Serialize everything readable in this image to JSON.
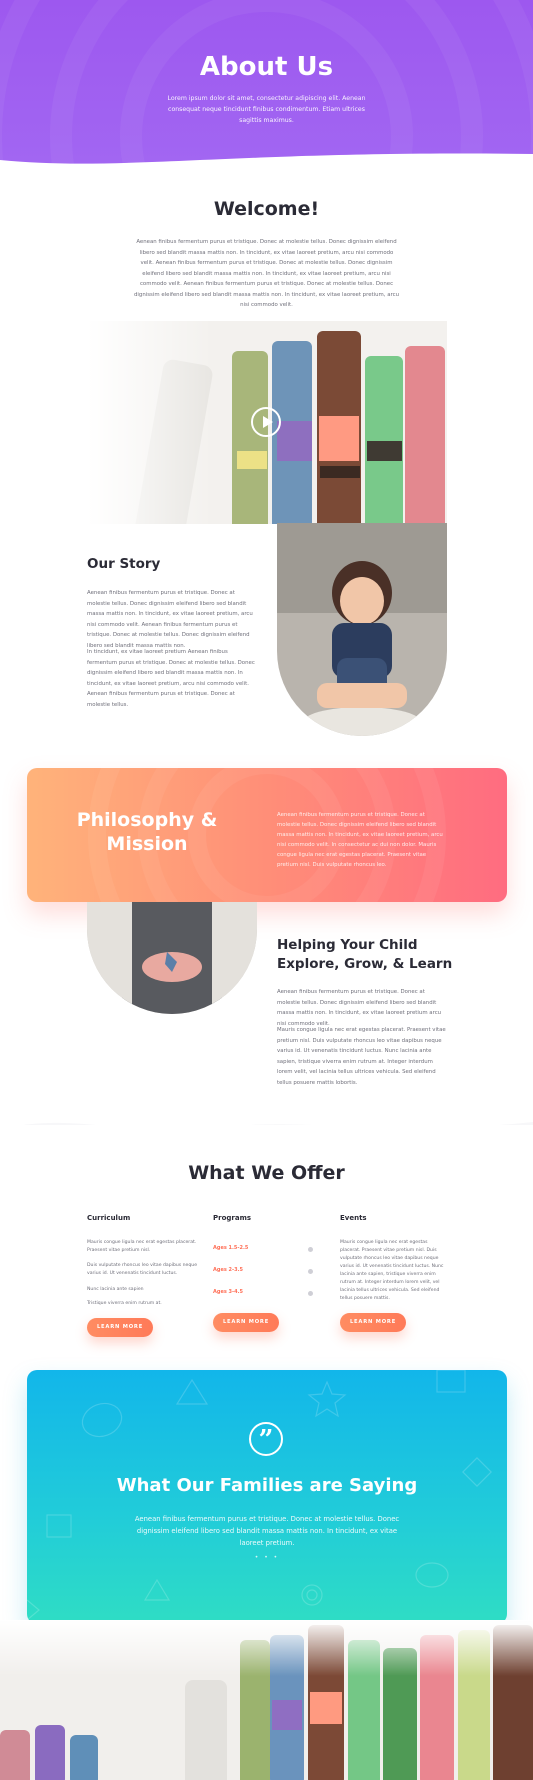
{
  "hero": {
    "title": "About Us",
    "subtitle": "Lorem ipsum dolor sit amet, consectetur adipiscing elit. Aenean consequat neque tincidunt finibus condimentum. Etiam ultrices sagittis maximus."
  },
  "welcome": {
    "title": "Welcome!",
    "text": "Aenean finibus fermentum purus et tristique. Donec at molestie tellus. Donec dignissim eleifend libero sed blandit massa mattis non. In tincidunt, ex vitae laoreet pretium, arcu nisi commodo velit. Aenean finibus fermentum purus et tristique. Donec at molestie tellus. Donec dignissim eleifend libero sed blandit massa mattis non. In tincidunt, ex vitae laoreet pretium, arcu nisi commodo velit. Aenean finibus fermentum purus et tristique. Donec at molestie tellus. Donec dignissim eleifend libero sed blandit massa mattis non. In tincidunt, ex vitae laoreet pretium, arcu nisi commodo velit."
  },
  "video": {
    "play_icon": "play-icon"
  },
  "story": {
    "title": "Our Story",
    "p1": "Aenean finibus fermentum purus et tristique. Donec at molestie tellus. Donec dignissim eleifend libero sed blandit massa mattis non. In tincidunt, ex vitae laoreet pretium, arcu nisi commodo velit. Aenean finibus fermentum purus et tristique. Donec at molestie tellus. Donec dignissim eleifend libero sed blandit massa mattis non.",
    "p2": "In tincidunt, ex vitae laoreet pretium Aenean finibus fermentum purus et tristique. Donec at molestie tellus. Donec dignissim eleifend libero sed blandit massa mattis non. In tincidunt, ex vitae laoreet pretium, arcu nisi commodo velit. Aenean finibus fermentum purus et tristique. Donec at molestie tellus."
  },
  "philosophy": {
    "title": "Philosophy & Mission",
    "text": "Aenean finibus fermentum purus et tristique. Donec at molestie tellus. Donec dignissim eleifend libero sed blandit massa mattis non. In tincidunt, ex vitae laoreet pretium, arcu nisi commodo velit. In consectetur ac dui non dolor. Mauris congue ligula nec erat egestas placerat. Praesent vitae pretium nisl. Duis vulputate rhoncus leo."
  },
  "help": {
    "title": "Helping Your Child Explore, Grow, & Learn",
    "p1": "Aenean finibus fermentum purus et tristique. Donec at molestie tellus. Donec dignissim eleifend libero sed blandit massa mattis non. In tincidunt, ex vitae laoreet pretium arcu nisi commodo velit.",
    "p2": "Mauris congue ligula nec erat egestas placerat. Praesent vitae pretium nisl. Duis vulputate rhoncus leo vitae dapibus neque varius id. Ut venenatis tincidunt luctus. Nunc lacinia ante sapien, tristique viverra enim rutrum at. Integer interdum lorem velit, vel lacinia tellus ultrices vehicula. Sed eleifend tellus posuere mattis lobortis."
  },
  "offer": {
    "title": "What We Offer",
    "curriculum": {
      "title": "Curriculum",
      "t1": "Mauris congue ligula nec erat egestas placerat. Praesent vitae pretium nisl.",
      "t2": "Duis vulputate rhoncus leo vitae dapibus neque varius id. Ut venenatis tincidunt luctus.",
      "t3": "Nunc lacinia ante sapien",
      "t4": "Tristique viverra enim rutrum at.",
      "button": "LEARN MORE"
    },
    "programs": {
      "title": "Programs",
      "ages": [
        "Ages 1.5-2.5",
        "Ages 2-3.5",
        "Ages 3-4.5"
      ],
      "button": "LEARN MORE"
    },
    "events": {
      "title": "Events",
      "text": "Mauris congue ligula nec erat egestas placerat. Praesent vitae pretium nisl. Duis vulputate rhoncus leo vitae dapibus neque varius id. Ut venenatis tincidunt luctus. Nunc lacinia ante sapien, tristique viverra enim rutrum at. Integer interdum lorem velit, vel lacinia tellus ultrices vehicula. Sed eleifend tellus posuere mattis.",
      "button": "LEARN MORE"
    }
  },
  "testimonial": {
    "quote_icon": "quote-icon",
    "quote_mark": "”",
    "title": "What Our Families are Saying",
    "text": "Aenean finibus fermentum purus et tristique. Donec at molestie tellus. Donec dignissim eleifend libero sed blandit massa mattis non. In tincidunt, ex vitae laoreet pretium.",
    "dots": "• • •"
  },
  "colors": {
    "hero_purple": "#9d58ef",
    "coral": "#ff7a58",
    "teal": "#22cdd8",
    "text_dark": "#2b2b36"
  }
}
